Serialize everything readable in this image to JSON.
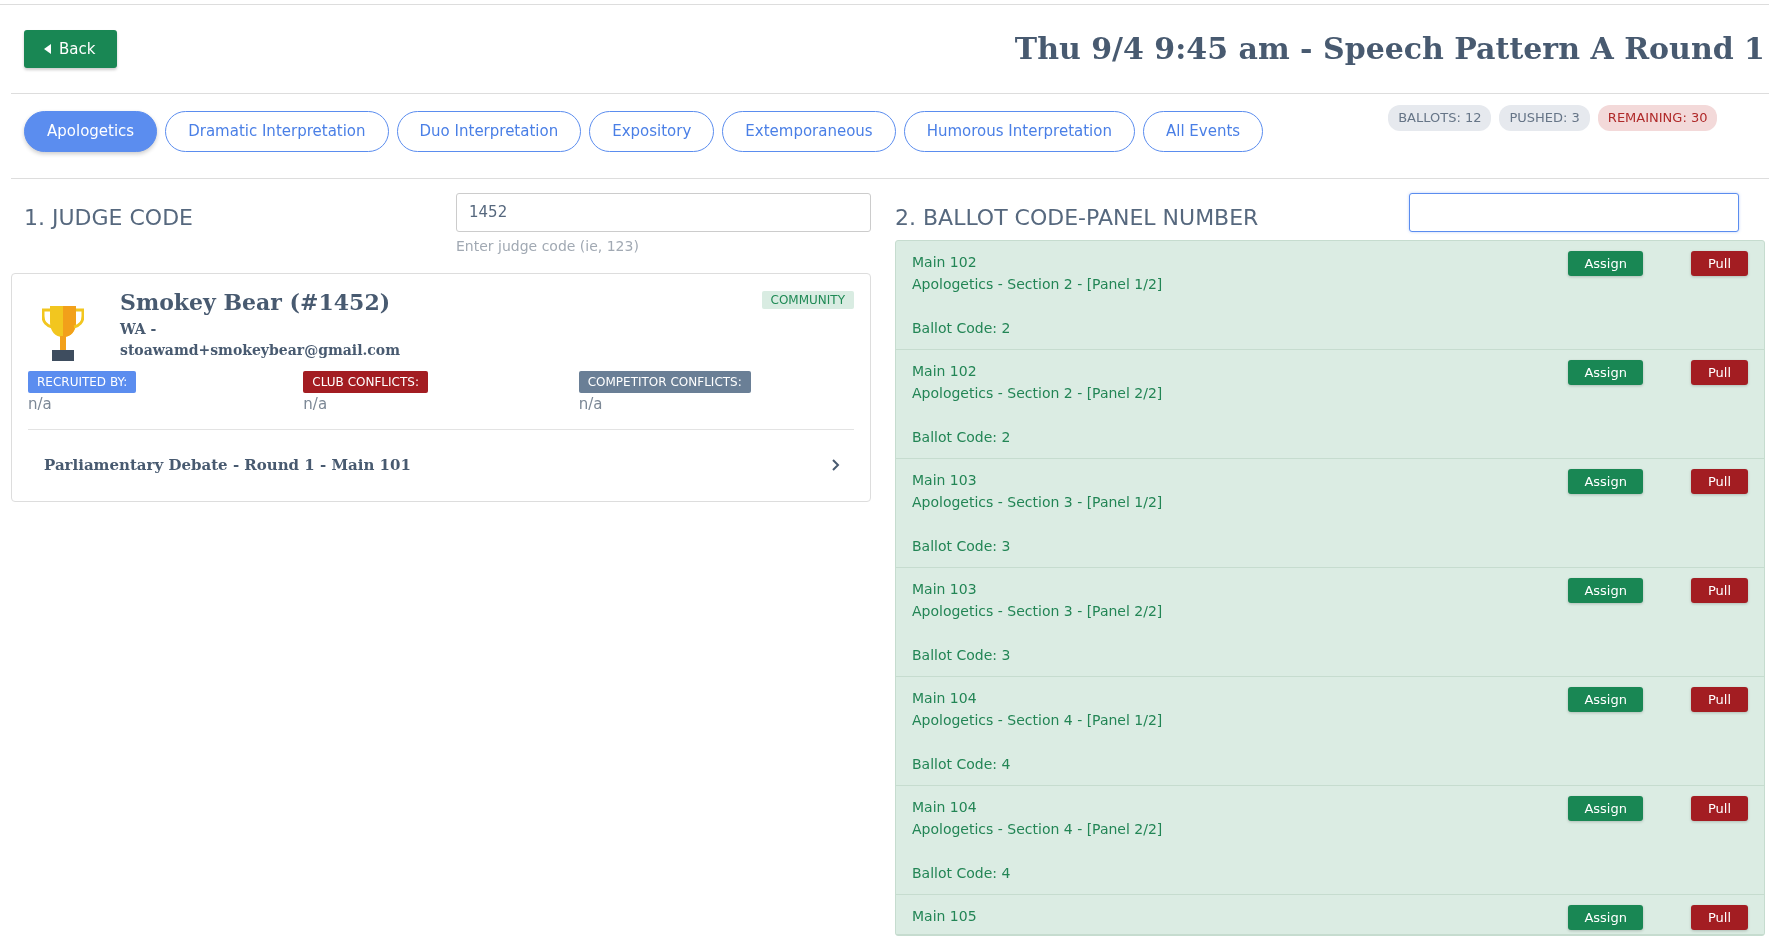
{
  "back_button": "Back",
  "title": "Thu 9/4 9:45 am - Speech Pattern A Round 1",
  "tabs": [
    {
      "label": "Apologetics",
      "selected": true
    },
    {
      "label": "Dramatic Interpretation",
      "selected": false
    },
    {
      "label": "Duo Interpretation",
      "selected": false
    },
    {
      "label": "Expository",
      "selected": false
    },
    {
      "label": "Extemporaneous",
      "selected": false
    },
    {
      "label": "Humorous Interpretation",
      "selected": false
    },
    {
      "label": "All Events",
      "selected": false
    }
  ],
  "counts": [
    {
      "label": "BALLOTS: 12",
      "kind": "neutral"
    },
    {
      "label": "PUSHED: 3",
      "kind": "neutral"
    },
    {
      "label": "REMAINING: 30",
      "kind": "danger"
    }
  ],
  "judge_section": {
    "heading": "1. JUDGE CODE",
    "input_value": "1452",
    "help": "Enter judge code (ie, 123)"
  },
  "judge": {
    "name": "Smokey Bear (#1452)",
    "state": "WA -",
    "email": "stoawamd+smokeybear@gmail.com",
    "type": "COMMUNITY",
    "fields": [
      {
        "label": "RECRUITED BY:",
        "kind": "primary",
        "value": "n/a"
      },
      {
        "label": "CLUB CONFLICTS:",
        "kind": "danger",
        "value": "n/a"
      },
      {
        "label": "COMPETITOR CONFLICTS:",
        "kind": "secondary",
        "value": "n/a"
      }
    ],
    "assignment": "Parliamentary Debate - Round 1 - Main 101"
  },
  "ballot_section": {
    "heading": "2. BALLOT CODE-PANEL NUMBER"
  },
  "ballots": [
    {
      "room": "Main 102",
      "event": "Apologetics - Section 2 - [Panel 1/2]",
      "code": "Ballot Code: 2",
      "assign": "Assign",
      "pull": "Pull"
    },
    {
      "room": "Main 102",
      "event": "Apologetics - Section 2 - [Panel 2/2]",
      "code": "Ballot Code: 2",
      "assign": "Assign",
      "pull": "Pull"
    },
    {
      "room": "Main 103",
      "event": "Apologetics - Section 3 - [Panel 1/2]",
      "code": "Ballot Code: 3",
      "assign": "Assign",
      "pull": "Pull"
    },
    {
      "room": "Main 103",
      "event": "Apologetics - Section 3 - [Panel 2/2]",
      "code": "Ballot Code: 3",
      "assign": "Assign",
      "pull": "Pull"
    },
    {
      "room": "Main 104",
      "event": "Apologetics - Section 4 - [Panel 1/2]",
      "code": "Ballot Code: 4",
      "assign": "Assign",
      "pull": "Pull"
    },
    {
      "room": "Main 104",
      "event": "Apologetics - Section 4 - [Panel 2/2]",
      "code": "Ballot Code: 4",
      "assign": "Assign",
      "pull": "Pull"
    },
    {
      "room": "Main 105",
      "assign": "Assign",
      "pull": "Pull"
    }
  ]
}
